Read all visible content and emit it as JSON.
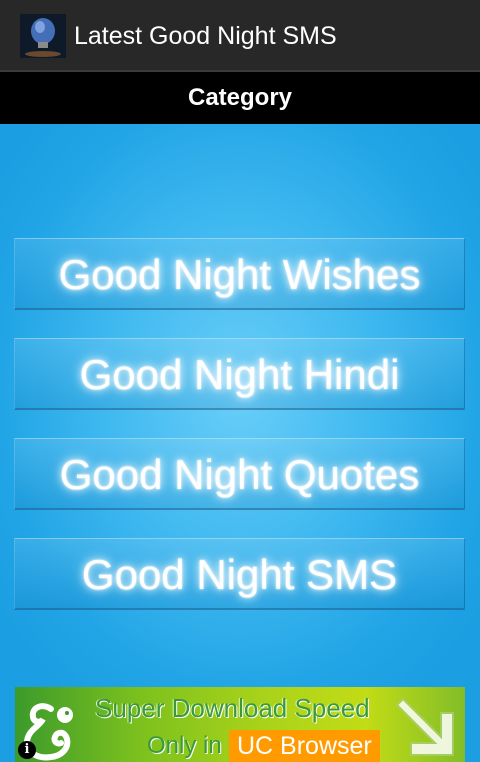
{
  "app": {
    "title": "Latest Good Night SMS",
    "icon": "lightbulb-app-icon"
  },
  "header": {
    "title": "Category"
  },
  "categories": [
    {
      "label": "Good Night Wishes"
    },
    {
      "label": "Good Night Hindi"
    },
    {
      "label": "Good Night Quotes"
    },
    {
      "label": "Good Night SMS"
    }
  ],
  "ad": {
    "line1": "Super Download Speed",
    "only_in": "Only in",
    "brand": "UC Browser",
    "logo_icon": "uc-squirrel-icon",
    "arrow_icon": "download-arrow-icon",
    "info_icon": "info-icon",
    "info_glyph": "i"
  },
  "colors": {
    "app_bar": "#282828",
    "category_bar": "#000000",
    "background": "#2aa9e6",
    "ad_green": "#7dc11e",
    "ad_orange": "#ff9a00"
  }
}
